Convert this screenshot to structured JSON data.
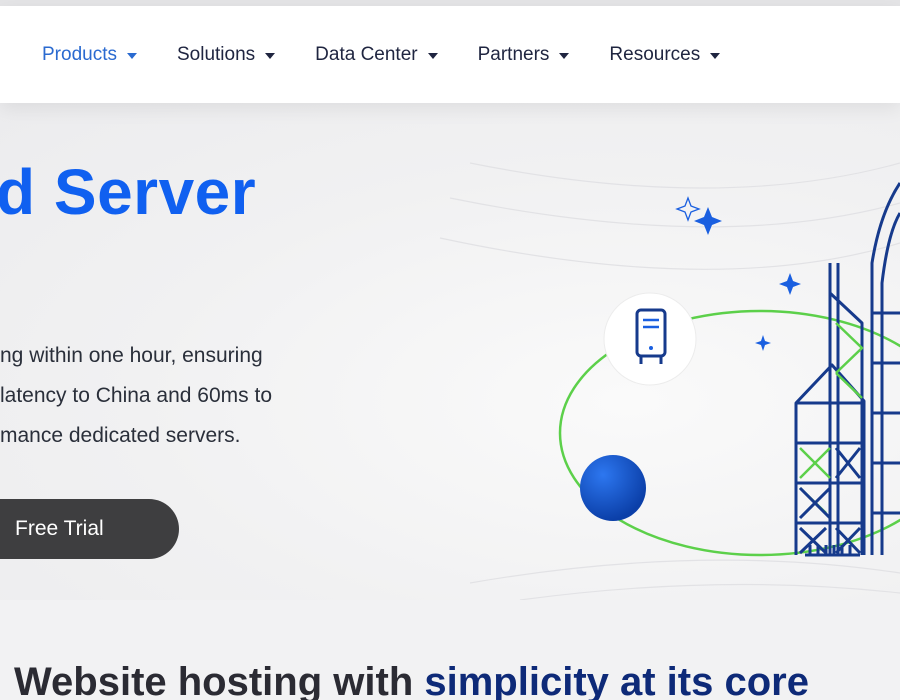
{
  "nav": {
    "items": [
      {
        "label": "Products",
        "active": true
      },
      {
        "label": "Solutions",
        "active": false
      },
      {
        "label": "Data Center",
        "active": false
      },
      {
        "label": "Partners",
        "active": false
      },
      {
        "label": "Resources",
        "active": false
      }
    ]
  },
  "hero": {
    "title": "d Server",
    "description": [
      "ng within one hour, ensuring",
      " latency to China and 60ms to",
      "mance dedicated servers."
    ],
    "cta_label": "Free Trial"
  },
  "section": {
    "title_regular": "Website hosting with ",
    "title_bold": "simplicity at its core"
  },
  "colors": {
    "accent": "#1060f0",
    "nav_active": "#2a6ad0",
    "dark_navy": "#0e2a78",
    "cta_bg": "#3e3e40",
    "green": "#5cd04a"
  },
  "icons": [
    "server-icon",
    "sparkle-icon",
    "globe-ball-icon",
    "skyscraper-illustration"
  ]
}
